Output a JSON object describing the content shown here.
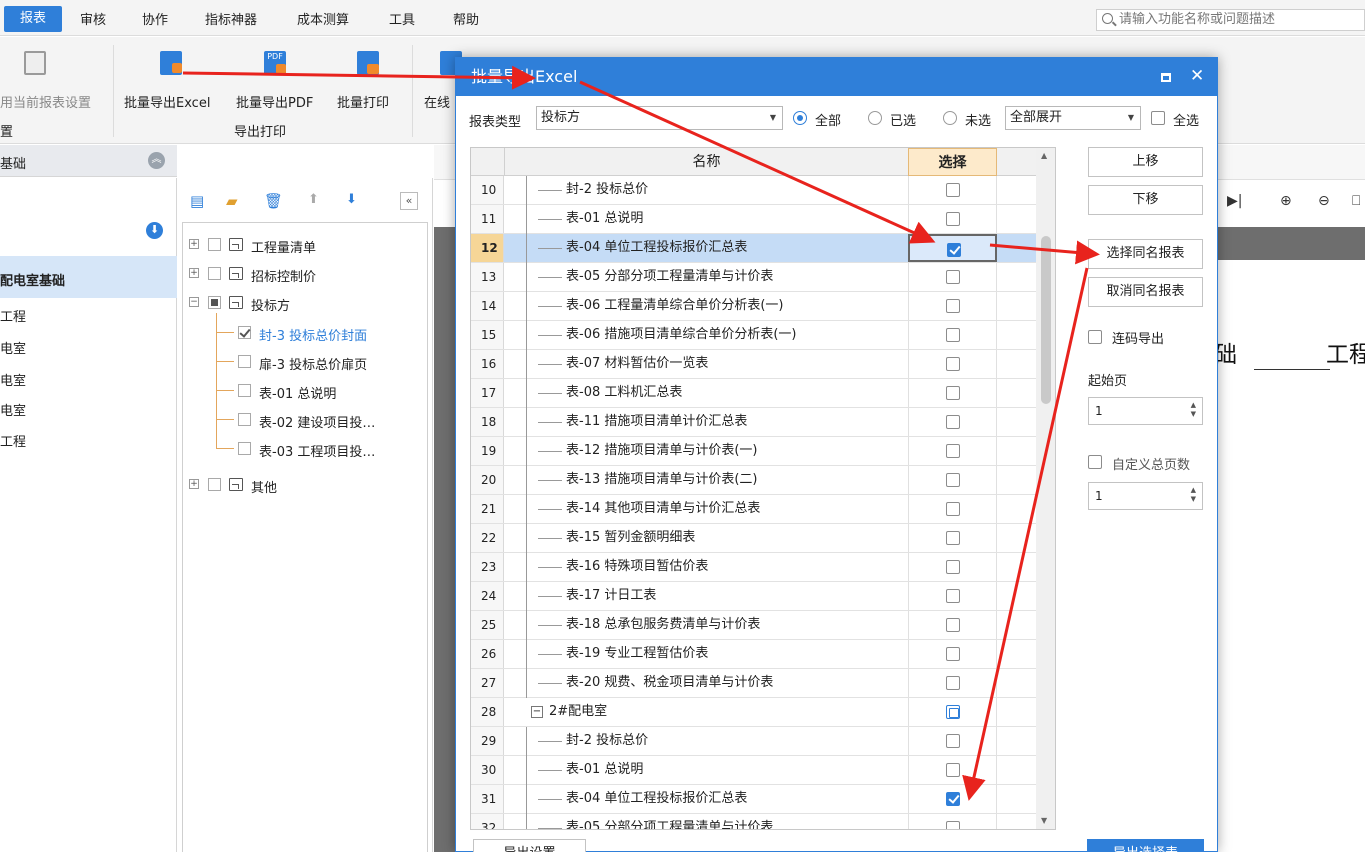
{
  "menubar": {
    "items": [
      "报表",
      "审核",
      "协作",
      "指标神器",
      "成本测算",
      "工具",
      "帮助"
    ],
    "search_placeholder": "请输入功能名称或问题描述"
  },
  "ribbon": {
    "apply_current": "用当前报表设置",
    "export_excel": "批量导出Excel",
    "export_pdf": "批量导出PDF",
    "batch_print": "批量打印",
    "online": "在线",
    "group_settings": "置",
    "group_export_print": "导出打印"
  },
  "left_panel": {
    "header": "基础",
    "items": [
      "配电室基础",
      "工程",
      "电室",
      "电室",
      "电室",
      "工程"
    ]
  },
  "tree": {
    "nodes": [
      {
        "label": "工程量清单"
      },
      {
        "label": "招标控制价"
      },
      {
        "label": "投标方"
      },
      {
        "label": "封-3 投标总价封面"
      },
      {
        "label": "扉-3 投标总价扉页"
      },
      {
        "label": "表-01 总说明"
      },
      {
        "label": "表-02 建设项目投…"
      },
      {
        "label": "表-03 工程项目投…"
      },
      {
        "label": "其他"
      }
    ]
  },
  "preview": {
    "text_a": "础",
    "text_b": "工程"
  },
  "dialog": {
    "title": "批量导出Excel",
    "report_type_label": "报表类型",
    "report_type_value": "投标方",
    "radio_all": "全部",
    "radio_selected": "已选",
    "radio_unselected": "未选",
    "expand_value": "全部展开",
    "select_all": "全选",
    "col_name": "名称",
    "col_select": "选择",
    "rows": [
      {
        "no": "10",
        "name": "封-2 投标总价",
        "checked": false
      },
      {
        "no": "11",
        "name": "表-01 总说明",
        "checked": false
      },
      {
        "no": "12",
        "name": "表-04 单位工程投标报价汇总表",
        "checked": true
      },
      {
        "no": "13",
        "name": "表-05 分部分项工程量清单与计价表",
        "checked": false
      },
      {
        "no": "14",
        "name": "表-06 工程量清单综合单价分析表(一)",
        "checked": false
      },
      {
        "no": "15",
        "name": "表-06 措施项目清单综合单价分析表(一)",
        "checked": false
      },
      {
        "no": "16",
        "name": "表-07 材料暂估价一览表",
        "checked": false
      },
      {
        "no": "17",
        "name": "表-08 工料机汇总表",
        "checked": false
      },
      {
        "no": "18",
        "name": "表-11 措施项目清单计价汇总表",
        "checked": false
      },
      {
        "no": "19",
        "name": "表-12 措施项目清单与计价表(一)",
        "checked": false
      },
      {
        "no": "20",
        "name": "表-13 措施项目清单与计价表(二)",
        "checked": false
      },
      {
        "no": "21",
        "name": "表-14 其他项目清单与计价汇总表",
        "checked": false
      },
      {
        "no": "22",
        "name": "表-15 暂列金额明细表",
        "checked": false
      },
      {
        "no": "23",
        "name": "表-16 特殊项目暂估价表",
        "checked": false
      },
      {
        "no": "24",
        "name": "表-17 计日工表",
        "checked": false
      },
      {
        "no": "25",
        "name": "表-18 总承包服务费清单与计价表",
        "checked": false
      },
      {
        "no": "26",
        "name": "表-19 专业工程暂估价表",
        "checked": false
      },
      {
        "no": "27",
        "name": "表-20 规费、税金项目清单与计价表",
        "checked": false
      },
      {
        "no": "28",
        "name": "2#配电室",
        "checked": "partial",
        "group": true
      },
      {
        "no": "29",
        "name": "封-2 投标总价",
        "checked": false
      },
      {
        "no": "30",
        "name": "表-01 总说明",
        "checked": false
      },
      {
        "no": "31",
        "name": "表-04 单位工程投标报价汇总表",
        "checked": true
      },
      {
        "no": "32",
        "name": "表-05 分部分项工程量清单与计价表",
        "checked": false
      }
    ],
    "btn_up": "上移",
    "btn_down": "下移",
    "btn_select_same": "选择同名报表",
    "btn_cancel_same": "取消同名报表",
    "continuous_export": "连码导出",
    "start_page_label": "起始页",
    "start_page_value": "1",
    "custom_total_label": "自定义总页数",
    "custom_total_value": "1",
    "bottom_left_btn": "导出设置",
    "bottom_right_btn": "导出选择表"
  },
  "colors": {
    "accent": "#2f7fd9",
    "annotation_arrow": "#e8231d",
    "row_highlight": "#c5dcf6"
  }
}
